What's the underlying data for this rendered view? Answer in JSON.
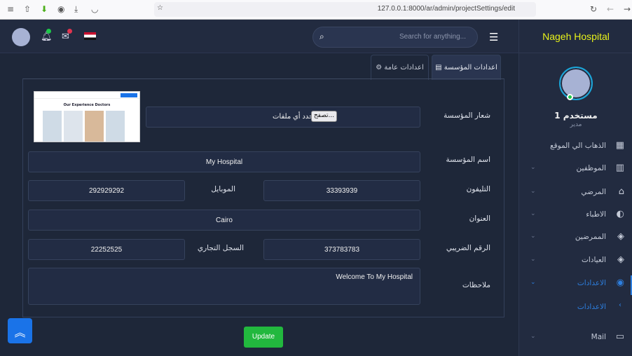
{
  "browser": {
    "url": "127.0.0.1:8000/ar/admin/projectSettings/edit"
  },
  "header": {
    "search_placeholder": "Search for anything...",
    "brand": "Nageh Hospital"
  },
  "user": {
    "name": "مستخدم 1",
    "role": "مدير"
  },
  "sidebar": {
    "items": [
      {
        "label": "الذهاب الي الموقع",
        "icon": "grid-icon",
        "glyph": "▦"
      },
      {
        "label": "الموظفين",
        "icon": "chart-icon",
        "glyph": "▥"
      },
      {
        "label": "المرضي",
        "icon": "basket-icon",
        "glyph": "⌂"
      },
      {
        "label": "الاطباء",
        "icon": "contrast-icon",
        "glyph": "◐"
      },
      {
        "label": "الممرضين",
        "icon": "layers-icon",
        "glyph": "◈"
      },
      {
        "label": "العيادات",
        "icon": "layers-icon",
        "glyph": "◈"
      },
      {
        "label": "الاعدادات",
        "icon": "palette-icon",
        "glyph": "◉"
      },
      {
        "label": "الاعدادات",
        "icon": "chevron-left-icon",
        "glyph": "‹"
      },
      {
        "label": "Mail",
        "icon": "chat-icon",
        "glyph": "▭"
      }
    ]
  },
  "tabs": [
    {
      "label": "اعدادات المؤسسة",
      "active": true
    },
    {
      "label": "اعدادات عامة",
      "active": false
    }
  ],
  "form": {
    "logo_label": "شعار المؤسسة",
    "browse_label": "تصفح...",
    "no_file": "لم تحدد أي ملفات.",
    "logo_preview_text": "Our Experience Doctors",
    "name_label": "اسم المؤسسة",
    "name_value": "My Hospital",
    "phone_label": "التليفون",
    "phone_value": "33393939",
    "mobile_label": "الموبايل",
    "mobile_value": "292929292",
    "address_label": "العنوان",
    "address_value": "Cairo",
    "tax_label": "الرقم الضريبي",
    "tax_value": "373783783",
    "commercial_label": "السجل التجاري",
    "commercial_value": "22252525",
    "notes_label": "ملاحظات",
    "notes_value": "Welcome To My Hospital",
    "update_label": "Update"
  },
  "colors": {
    "accent": "#2d7fe0",
    "brand": "#e8f21a",
    "update": "#22b83e"
  }
}
